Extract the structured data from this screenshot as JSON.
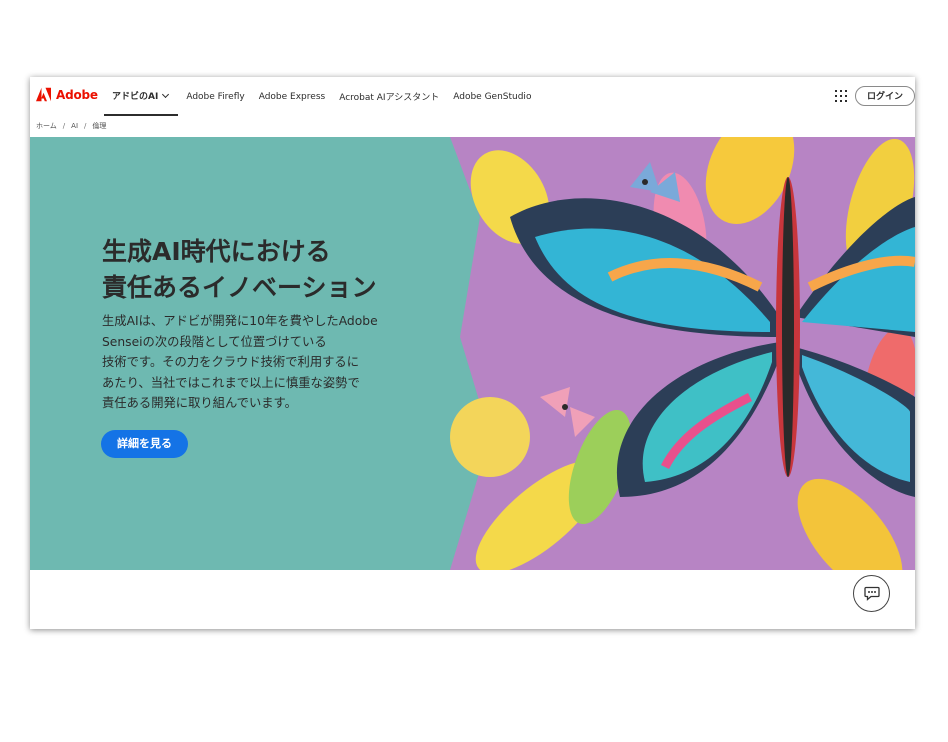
{
  "header": {
    "brand": "Adobe",
    "nav": [
      {
        "label": "アドビのAI",
        "has_dropdown": true
      },
      {
        "label": "Adobe Firefly"
      },
      {
        "label": "Adobe Express"
      },
      {
        "label": "Acrobat AIアシスタント"
      },
      {
        "label": "Adobe GenStudio"
      }
    ],
    "apps_icon": "grid-9-dots-icon",
    "login_label": "ログイン"
  },
  "breadcrumb": [
    "ホーム",
    "AI",
    "倫理"
  ],
  "hero": {
    "title_lines": [
      "生成AI時代における",
      "責任あるイノベーション"
    ],
    "body_lines": [
      "生成AIは、アドビが開発に10年を費やしたAdobe",
      "Senseiの次の段階として位置づけている",
      "技術です。その力をクラウド技術で利用するに",
      "あたり、当社ではこれまで以上に慎重な姿勢で",
      "責任ある開発に取り組んでいます。"
    ],
    "cta_label": "詳細を見る",
    "image": "paper-craft-butterfly-illustration"
  },
  "chat_icon": "chat-bubble-icon",
  "colors": {
    "brand_red": "#eb1000",
    "hero_bg": "#6eb9b1",
    "cta_blue": "#1473e6",
    "art_bg": "#b784c4"
  }
}
